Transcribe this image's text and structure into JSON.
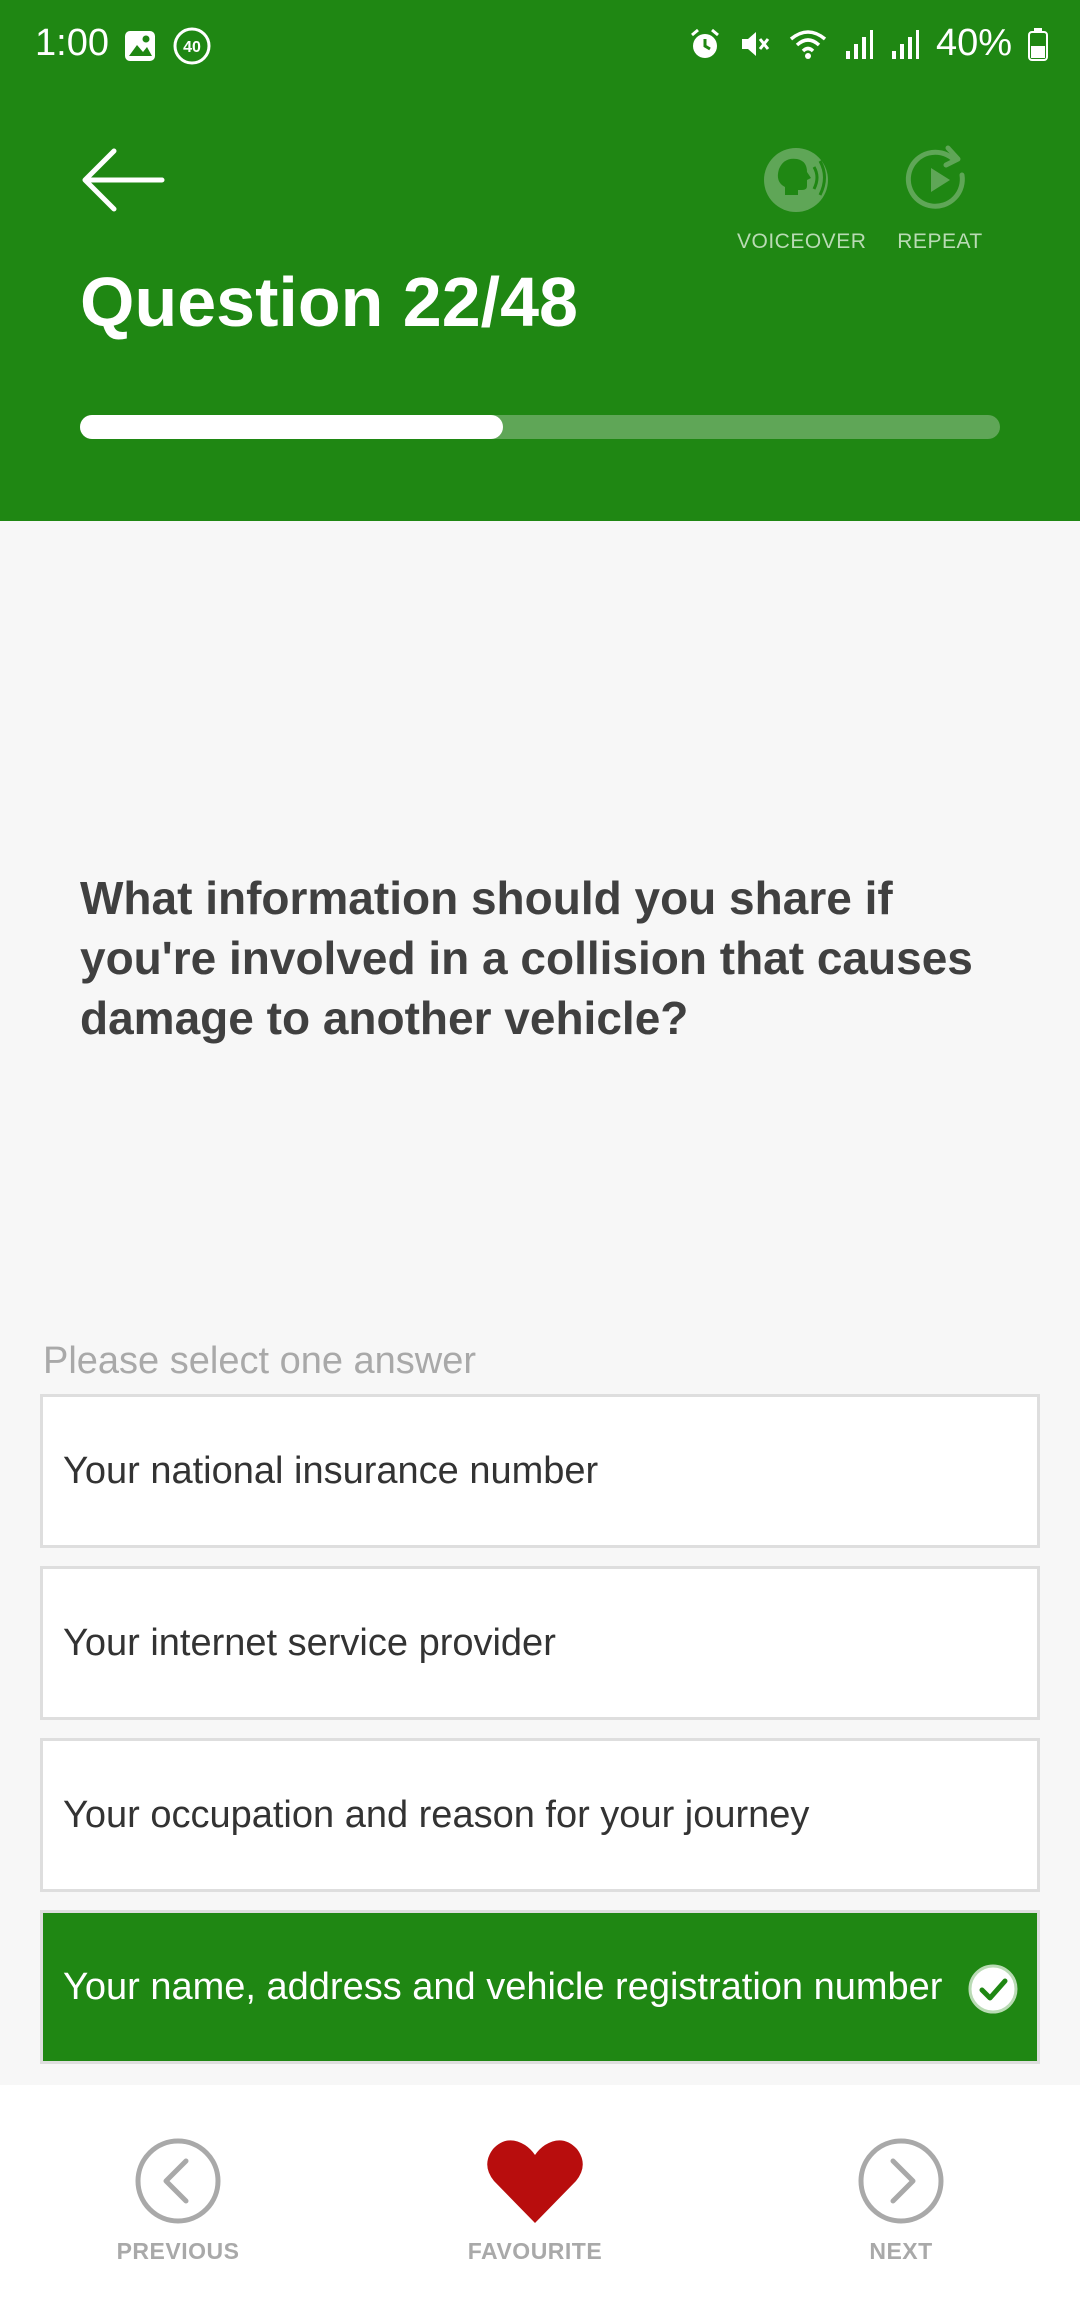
{
  "status_bar": {
    "time": "1:00",
    "badge": "40",
    "battery": "40%",
    "icons": [
      "gallery-icon",
      "badge-icon",
      "alarm-icon",
      "mute-icon",
      "wifi-icon",
      "signal-icon",
      "signal-icon",
      "battery-icon"
    ]
  },
  "header": {
    "title": "Question 22/48",
    "voiceover_label": "VOICEOVER",
    "repeat_label": "REPEAT",
    "progress": 0.46
  },
  "question": {
    "text": "What information should you share if you're involved in a collision that causes damage to another vehicle?"
  },
  "answers": {
    "hint": "Please select one answer",
    "options": [
      {
        "label": "Your national insurance number",
        "selected": false
      },
      {
        "label": "Your internet service provider",
        "selected": false
      },
      {
        "label": "Your occupation and reason for your journey",
        "selected": false
      },
      {
        "label": "Your name, address and vehicle registration number",
        "selected": true
      }
    ]
  },
  "bottom_nav": {
    "previous": "PREVIOUS",
    "favourite": "FAVOURITE",
    "next": "NEXT"
  },
  "colors": {
    "brand_green": "#1f8713",
    "favourite_red": "#b80d0d"
  }
}
